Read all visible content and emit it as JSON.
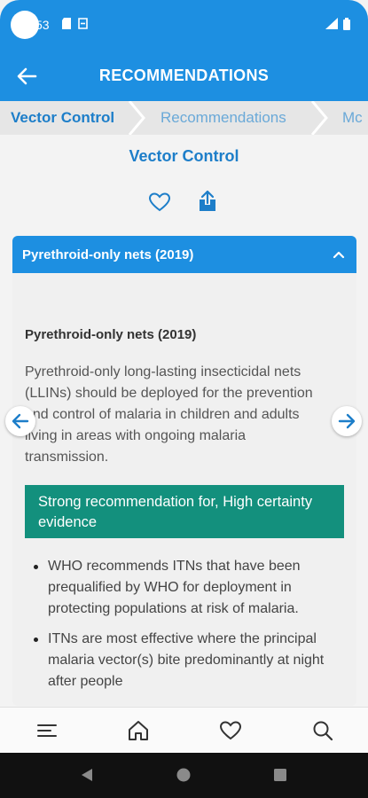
{
  "status_bar": {
    "time": "53"
  },
  "app_bar": {
    "title": "RECOMMENDATIONS"
  },
  "breadcrumb": {
    "items": [
      "Vector Control",
      "Recommendations",
      "Mc"
    ]
  },
  "page": {
    "title": "Vector Control"
  },
  "card": {
    "header_title": "Pyrethroid-only nets (2019)",
    "section_title": "Pyrethroid-only nets (2019)",
    "section_text": "Pyrethroid-only long-lasting insecticidal nets (LLINs) should be deployed for the prevention and control of malaria in children and adults living in areas with ongoing malaria transmission.",
    "strength": "Strong recommendation for, High certainty evidence",
    "bullets": [
      "WHO recommends ITNs that have been prequalified by WHO for deployment in protecting populations at risk of malaria.",
      "ITNs are most effective where the principal malaria vector(s) bite predominantly at night after people"
    ]
  },
  "colors": {
    "primary": "#1d8fe1",
    "breadcrumb_active": "#1d7ec9",
    "strength_bg": "#13907d"
  },
  "icons": [
    "back-arrow-icon",
    "heart-icon",
    "share-icon",
    "chevron-up-icon",
    "arrow-left-icon",
    "arrow-right-icon",
    "menu-icon",
    "home-icon",
    "search-icon"
  ]
}
